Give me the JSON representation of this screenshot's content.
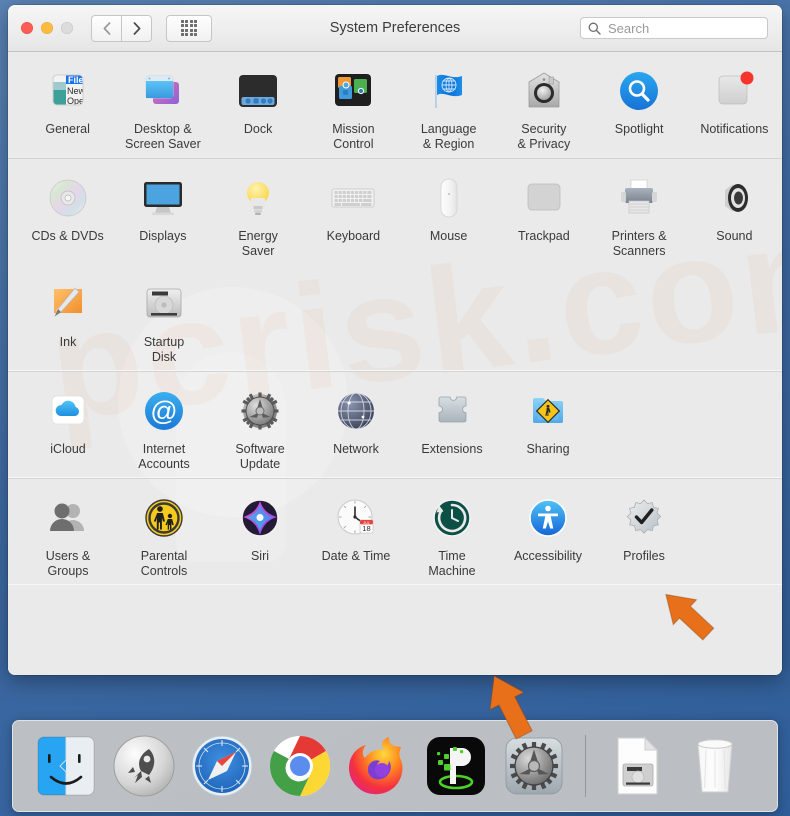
{
  "window": {
    "title": "System Preferences",
    "traffic_lights": [
      "close",
      "minimize",
      "zoom"
    ],
    "nav_back": "‹",
    "nav_forward": "›",
    "grid_button": "show-all-grid"
  },
  "search": {
    "placeholder": "Search",
    "value": "",
    "icon": "search-icon"
  },
  "sections": [
    {
      "name": "personal",
      "rows": [
        [
          {
            "label": "General",
            "icon": "general-icon"
          },
          {
            "label": "Desktop &\nScreen Saver",
            "icon": "desktop-screensaver-icon"
          },
          {
            "label": "Dock",
            "icon": "dock-icon"
          },
          {
            "label": "Mission\nControl",
            "icon": "mission-control-icon"
          },
          {
            "label": "Language\n& Region",
            "icon": "language-region-icon"
          },
          {
            "label": "Security\n& Privacy",
            "icon": "security-privacy-icon"
          },
          {
            "label": "Spotlight",
            "icon": "spotlight-icon"
          },
          {
            "label": "Notifications",
            "icon": "notifications-icon"
          }
        ]
      ]
    },
    {
      "name": "hardware",
      "rows": [
        [
          {
            "label": "CDs & DVDs",
            "icon": "cds-dvds-icon"
          },
          {
            "label": "Displays",
            "icon": "displays-icon"
          },
          {
            "label": "Energy\nSaver",
            "icon": "energy-saver-icon"
          },
          {
            "label": "Keyboard",
            "icon": "keyboard-icon"
          },
          {
            "label": "Mouse",
            "icon": "mouse-icon"
          },
          {
            "label": "Trackpad",
            "icon": "trackpad-icon"
          },
          {
            "label": "Printers &\nScanners",
            "icon": "printers-scanners-icon"
          },
          {
            "label": "Sound",
            "icon": "sound-icon"
          }
        ],
        [
          {
            "label": "Ink",
            "icon": "ink-icon"
          },
          {
            "label": "Startup\nDisk",
            "icon": "startup-disk-icon"
          }
        ]
      ]
    },
    {
      "name": "internet-wireless",
      "rows": [
        [
          {
            "label": "iCloud",
            "icon": "icloud-icon"
          },
          {
            "label": "Internet\nAccounts",
            "icon": "internet-accounts-icon"
          },
          {
            "label": "Software\nUpdate",
            "icon": "software-update-icon"
          },
          {
            "label": "Network",
            "icon": "network-icon"
          },
          {
            "label": "Extensions",
            "icon": "extensions-icon"
          },
          {
            "label": "Sharing",
            "icon": "sharing-icon"
          }
        ]
      ]
    },
    {
      "name": "system",
      "rows": [
        [
          {
            "label": "Users &\nGroups",
            "icon": "users-groups-icon"
          },
          {
            "label": "Parental\nControls",
            "icon": "parental-controls-icon"
          },
          {
            "label": "Siri",
            "icon": "siri-icon"
          },
          {
            "label": "Date & Time",
            "icon": "date-time-icon"
          },
          {
            "label": "Time\nMachine",
            "icon": "time-machine-icon"
          },
          {
            "label": "Accessibility",
            "icon": "accessibility-icon"
          },
          {
            "label": "Profiles",
            "icon": "profiles-icon"
          }
        ]
      ]
    }
  ],
  "date_time_icon": {
    "month": "JUL",
    "day": "18"
  },
  "dock": {
    "items": [
      {
        "name": "Finder",
        "icon": "finder-icon"
      },
      {
        "name": "Launchpad",
        "icon": "launchpad-icon"
      },
      {
        "name": "Safari",
        "icon": "safari-icon"
      },
      {
        "name": "Google Chrome",
        "icon": "chrome-icon"
      },
      {
        "name": "Firefox",
        "icon": "firefox-icon"
      },
      {
        "name": "iPulse",
        "icon": "ipulse-icon"
      },
      {
        "name": "System Preferences",
        "icon": "system-preferences-icon"
      }
    ],
    "separator": "dock-separator",
    "right_items": [
      {
        "name": "Macintosh HD document",
        "icon": "document-disk-icon"
      },
      {
        "name": "Trash",
        "icon": "trash-icon"
      }
    ]
  },
  "annotations": [
    {
      "name": "arrow-pointing-to-profiles",
      "target": "Profiles",
      "color": "#E8701A"
    },
    {
      "name": "arrow-pointing-to-system-preferences-dock",
      "target": "System Preferences",
      "color": "#E8701A"
    }
  ],
  "colors": {
    "accent_orange": "#E8701A",
    "desktop_blue": "#3f6ba4",
    "window_bg": "#eaeaea",
    "titlebar_bg": "#f0f0f0"
  },
  "watermark": {
    "text": "pcrisk.com"
  }
}
